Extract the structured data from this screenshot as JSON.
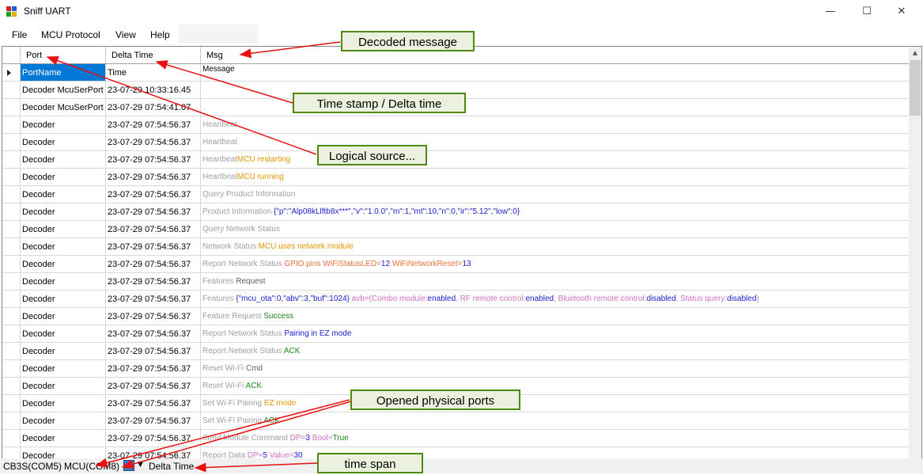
{
  "window": {
    "title": "Sniff UART",
    "minimize": "—",
    "maximize": "☐",
    "close": "✕"
  },
  "menu": {
    "items": [
      "File",
      "MCU Protocol",
      "View",
      "Help"
    ]
  },
  "grid": {
    "columns": [
      "Port",
      "Delta Time",
      "Msg"
    ],
    "rows": [
      {
        "port": "PortName",
        "time": "Time",
        "parts": [
          {
            "t": "Message",
            "c": "#000000"
          }
        ]
      },
      {
        "port": "Decoder McuSerPort",
        "time": "23-07-29 10:33:16.45",
        "parts": []
      },
      {
        "port": "Decoder McuSerPort",
        "time": "23-07-29 07:54:41.07",
        "parts": []
      },
      {
        "port": "Decoder",
        "time": "23-07-29 07:54:56.37",
        "parts": [
          {
            "t": "Heartbeat",
            "c": "#a0a0a0"
          }
        ]
      },
      {
        "port": "Decoder",
        "time": "23-07-29 07:54:56.37",
        "parts": [
          {
            "t": "Heartbeat",
            "c": "#a0a0a0"
          }
        ]
      },
      {
        "port": "Decoder",
        "time": "23-07-29 07:54:56.37",
        "parts": [
          {
            "t": "Heartbeat",
            "c": "#a0a0a0"
          },
          {
            "t": "MCU restarting",
            "c": "#e69500"
          }
        ]
      },
      {
        "port": "Decoder",
        "time": "23-07-29 07:54:56.37",
        "parts": [
          {
            "t": "Heartbeat",
            "c": "#a0a0a0"
          },
          {
            "t": "MCU running",
            "c": "#e69500"
          }
        ]
      },
      {
        "port": "Decoder",
        "time": "23-07-29 07:54:56.37",
        "parts": [
          {
            "t": "Query Product Information",
            "c": "#a0a0a0"
          }
        ]
      },
      {
        "port": "Decoder",
        "time": "23-07-29 07:54:56.37",
        "parts": [
          {
            "t": "Product Information ",
            "c": "#a0a0a0"
          },
          {
            "t": "{\"p\":\"Alp08kLlftb8x***\",\"v\":\"1.0.0\",\"m\":1,\"mt\":10,\"n\":0,\"ir\":\"5.12\",\"low\":0}",
            "c": "#1a1ad0"
          }
        ]
      },
      {
        "port": "Decoder",
        "time": "23-07-29 07:54:56.37",
        "parts": [
          {
            "t": "Query Network Status",
            "c": "#a0a0a0"
          }
        ]
      },
      {
        "port": "Decoder",
        "time": "23-07-29 07:54:56.37",
        "parts": [
          {
            "t": "Network Status ",
            "c": "#a0a0a0"
          },
          {
            "t": "MCU uses network module",
            "c": "#e69500"
          }
        ]
      },
      {
        "port": "Decoder",
        "time": "23-07-29 07:54:56.37",
        "parts": [
          {
            "t": "Report Network Status ",
            "c": "#a0a0a0"
          },
          {
            "t": "GPIO pins WiFiStatusLED=",
            "c": "#e8703a"
          },
          {
            "t": "12",
            "c": "#1a1ad0"
          },
          {
            "t": " WiFiNetworkReset=",
            "c": "#e8703a"
          },
          {
            "t": "13",
            "c": "#1a1ad0"
          }
        ]
      },
      {
        "port": "Decoder",
        "time": "23-07-29 07:54:56.37",
        "parts": [
          {
            "t": "Features ",
            "c": "#a0a0a0"
          },
          {
            "t": "Request",
            "c": "#606060"
          }
        ]
      },
      {
        "port": "Decoder",
        "time": "23-07-29 07:54:56.37",
        "parts": [
          {
            "t": "Features ",
            "c": "#a0a0a0"
          },
          {
            "t": "{\"mcu_ota\":0,\"abv\":3,\"buf\":1024}",
            "c": "#1a1ad0"
          },
          {
            "t": " avb=(Combo module:",
            "c": "#d070c0"
          },
          {
            "t": "enabled",
            "c": "#1a1ad0"
          },
          {
            "t": ", RF remote control:",
            "c": "#d070c0"
          },
          {
            "t": "enabled",
            "c": "#1a1ad0"
          },
          {
            "t": ", Bluetooth remote control:",
            "c": "#d070c0"
          },
          {
            "t": "disabled",
            "c": "#1a1ad0"
          },
          {
            "t": ", Status query:",
            "c": "#d070c0"
          },
          {
            "t": "disabled",
            "c": "#1a1ad0"
          },
          {
            "t": ")",
            "c": "#d070c0"
          }
        ]
      },
      {
        "port": "Decoder",
        "time": "23-07-29 07:54:56.37",
        "parts": [
          {
            "t": "Feature Request ",
            "c": "#a0a0a0"
          },
          {
            "t": "Success",
            "c": "#1a8a1a"
          }
        ]
      },
      {
        "port": "Decoder",
        "time": "23-07-29 07:54:56.37",
        "parts": [
          {
            "t": "Report Network Status ",
            "c": "#a0a0a0"
          },
          {
            "t": "Pairing in EZ mode",
            "c": "#1a1ad0"
          }
        ]
      },
      {
        "port": "Decoder",
        "time": "23-07-29 07:54:56.37",
        "parts": [
          {
            "t": "Report Network Status ",
            "c": "#a0a0a0"
          },
          {
            "t": "ACK",
            "c": "#1a8a1a"
          }
        ]
      },
      {
        "port": "Decoder",
        "time": "23-07-29 07:54:56.37",
        "parts": [
          {
            "t": "Reset Wi-Fi ",
            "c": "#a0a0a0"
          },
          {
            "t": "Cmd",
            "c": "#606060"
          }
        ]
      },
      {
        "port": "Decoder",
        "time": "23-07-29 07:54:56.37",
        "parts": [
          {
            "t": "Reset Wi-Fi ",
            "c": "#a0a0a0"
          },
          {
            "t": "ACK",
            "c": "#1a8a1a"
          }
        ]
      },
      {
        "port": "Decoder",
        "time": "23-07-29 07:54:56.37",
        "parts": [
          {
            "t": "Set Wi-Fi Pairing ",
            "c": "#a0a0a0"
          },
          {
            "t": "EZ mode",
            "c": "#e69500"
          }
        ]
      },
      {
        "port": "Decoder",
        "time": "23-07-29 07:54:56.37",
        "parts": [
          {
            "t": "Set Wi-Fi Pairing ",
            "c": "#a0a0a0"
          },
          {
            "t": "ACK",
            "c": "#1a8a1a"
          }
        ]
      },
      {
        "port": "Decoder",
        "time": "23-07-29 07:54:56.37",
        "parts": [
          {
            "t": "Send Module Command ",
            "c": "#a0a0a0"
          },
          {
            "t": "DP=",
            "c": "#d070c0"
          },
          {
            "t": "3",
            "c": "#1a1ad0"
          },
          {
            "t": " Bool=",
            "c": "#d070c0"
          },
          {
            "t": "True",
            "c": "#1a8a1a"
          }
        ]
      },
      {
        "port": "Decoder",
        "time": "23-07-29 07:54:56.37",
        "parts": [
          {
            "t": "Report Data ",
            "c": "#a0a0a0"
          },
          {
            "t": "DP=",
            "c": "#d070c0"
          },
          {
            "t": "5",
            "c": "#1a1ad0"
          },
          {
            "t": " Value=",
            "c": "#d070c0"
          },
          {
            "t": "30",
            "c": "#1a1ad0"
          }
        ]
      }
    ]
  },
  "statusbar": {
    "port1": "CB3S(COM5)",
    "port2": "MCU(COM8)",
    "mode": "Delta Time"
  },
  "callouts": {
    "decoded": "Decoded message",
    "timestamp": "Time stamp / Delta time",
    "logical": "Logical  source...",
    "physical": "Opened physical ports",
    "timespan": "time span"
  },
  "colors": {
    "selection": "#0078d7",
    "callout_bg": "#ebf1de",
    "callout_border": "#4f8a10",
    "arrow": "#e81010"
  }
}
